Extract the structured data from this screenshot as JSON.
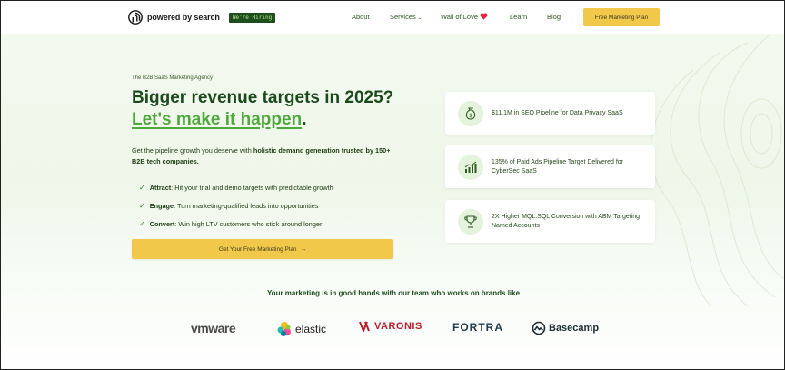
{
  "header": {
    "brand_name": "powered by search",
    "hiring_badge": "We're Hiring",
    "nav": [
      {
        "label": "About"
      },
      {
        "label": "Services"
      },
      {
        "label": "Wall of Love"
      },
      {
        "label": "Learn"
      },
      {
        "label": "Blog"
      }
    ],
    "cta_label": "Free Marketing Plan"
  },
  "hero": {
    "eyebrow": "The B2B SaaS Marketing Agency",
    "headline_main": "Bigger revenue targets in 2025?",
    "headline_highlight": "Let's make it happen",
    "headline_end": ".",
    "lead_plain": "Get the pipeline growth you deserve with",
    "lead_bold": "holistic demand generation trusted by 150+ B2B tech companies.",
    "bullets": [
      {
        "term": "Attract",
        "text": ": Hit your trial and demo targets with predictable growth"
      },
      {
        "term": "Engage",
        "text": ": Turn marketing-qualified leads into opportunities"
      },
      {
        "term": "Convert",
        "text": ": Win high LTV customers who stick around longer"
      }
    ],
    "cta_label": "Get Your Free Marketing Plan",
    "cta_arrow": "→"
  },
  "stats": [
    {
      "icon": "money-bag-icon",
      "text": "$11.1M in SEO Pipeline for Data Privacy SaaS"
    },
    {
      "icon": "growth-chart-icon",
      "text": "135% of Paid Ads Pipeline Target Delivered for CyberSec SaaS"
    },
    {
      "icon": "trophy-icon",
      "text": "2X Higher MQL:SQL Conversion with ABM Targeting Named Accounts"
    }
  ],
  "trust": {
    "heading": "Your marketing is in good hands with our team who works on brands like",
    "brands": [
      "vmware",
      "elastic",
      "VARONIS",
      "FORTRA",
      "Basecamp"
    ]
  },
  "colors": {
    "accent_yellow": "#f2c84b",
    "brand_green": "#1d4a1d",
    "highlight_green": "#4fa83d"
  }
}
